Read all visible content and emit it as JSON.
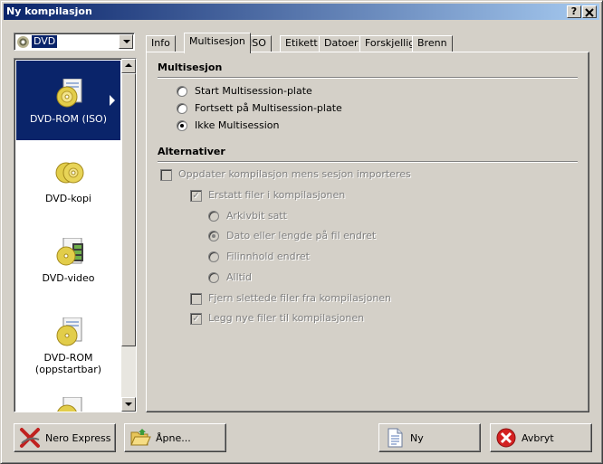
{
  "window": {
    "title": "Ny kompilasjon",
    "help_label": "?",
    "close_label": "X"
  },
  "media_combo": {
    "value": "DVD"
  },
  "compilation_types": [
    {
      "label": "DVD-ROM (ISO)",
      "icon": "dvd-rom-iso-icon",
      "selected": true
    },
    {
      "label": "DVD-kopi",
      "icon": "dvd-copy-icon"
    },
    {
      "label": "DVD-video",
      "icon": "dvd-video-icon"
    },
    {
      "label": "DVD-ROM (oppstartbar)",
      "icon": "dvd-rom-bootable-icon"
    },
    {
      "label": "",
      "icon": "dvd-more-icon"
    }
  ],
  "tabs": [
    {
      "label": "Info"
    },
    {
      "label": "Multisesjon",
      "active": true
    },
    {
      "label": "ISO"
    },
    {
      "label": "Etikett"
    },
    {
      "label": "Datoer"
    },
    {
      "label": "Forskjellig"
    },
    {
      "label": "Brenn"
    }
  ],
  "multisession": {
    "heading": "Multisesjon",
    "options": [
      {
        "label": "Start Multisession-plate",
        "checked": false
      },
      {
        "label": "Fortsett på Multisession-plate",
        "checked": false
      },
      {
        "label": "Ikke Multisession",
        "checked": true
      }
    ]
  },
  "alternatives": {
    "heading": "Alternativer",
    "update_label": "Oppdater kompilasjon mens sesjon importeres",
    "replace_label": "Erstatt filer i kompilasjonen",
    "replace_options": [
      {
        "label": "Arkivbit satt",
        "checked": false
      },
      {
        "label": "Dato eller lengde på fil endret",
        "checked": true
      },
      {
        "label": "Filinnhold endret",
        "checked": false
      },
      {
        "label": "Alltid",
        "checked": false
      }
    ],
    "remove_deleted_label": "Fjern slettede filer fra kompilasjonen",
    "add_new_label": "Legg nye filer til kompilasjonen",
    "checkmark": "✓"
  },
  "buttons": {
    "nero_express": "Nero Express",
    "open": "Åpne...",
    "new": "Ny",
    "cancel": "Avbryt"
  }
}
